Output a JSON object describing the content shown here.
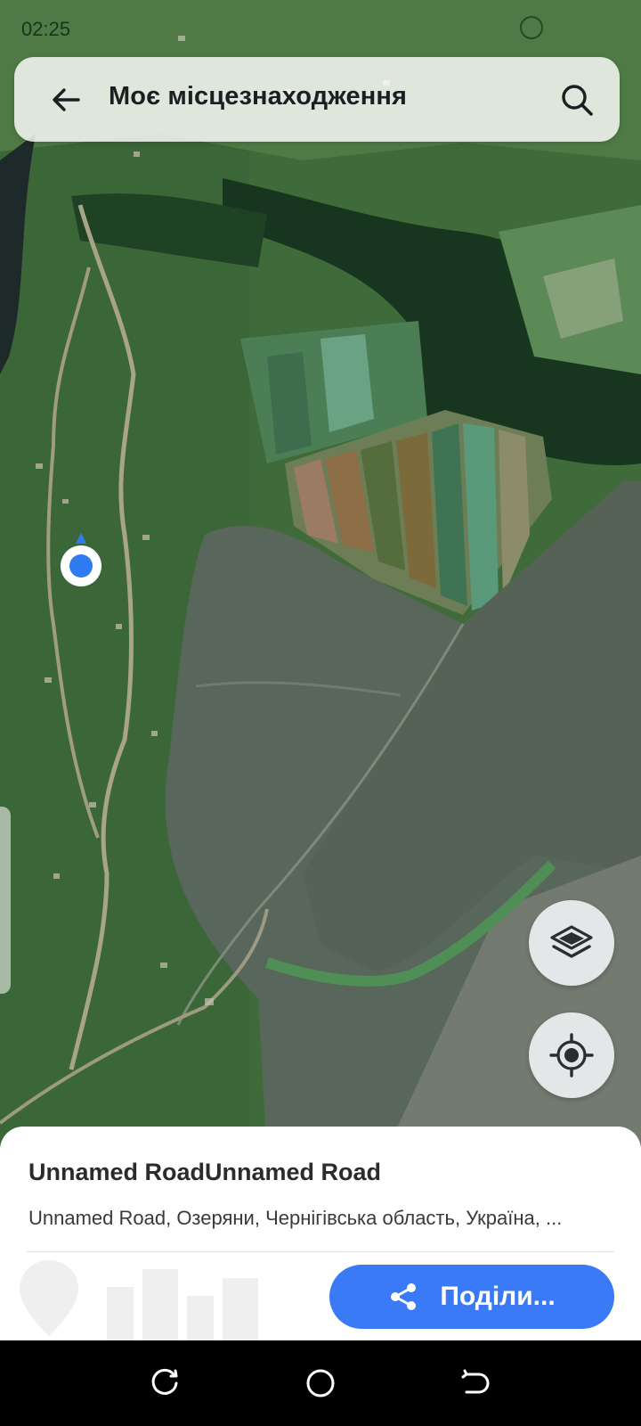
{
  "status": {
    "time": "02:25"
  },
  "search": {
    "title": "Моє місцезнаходження"
  },
  "icons": {
    "back": "arrow-left-icon",
    "search": "search-icon",
    "layers": "layers-icon",
    "locate": "my-location-icon",
    "share": "share-icon"
  },
  "place": {
    "title": "Unnamed RoadUnnamed Road",
    "address": "Unnamed Road, Озеряни, Чернігівська область, Україна, ..."
  },
  "actions": {
    "share_label": "Поділи..."
  },
  "colors": {
    "accent": "#3b7af6",
    "location_dot": "#2f7bf2"
  }
}
